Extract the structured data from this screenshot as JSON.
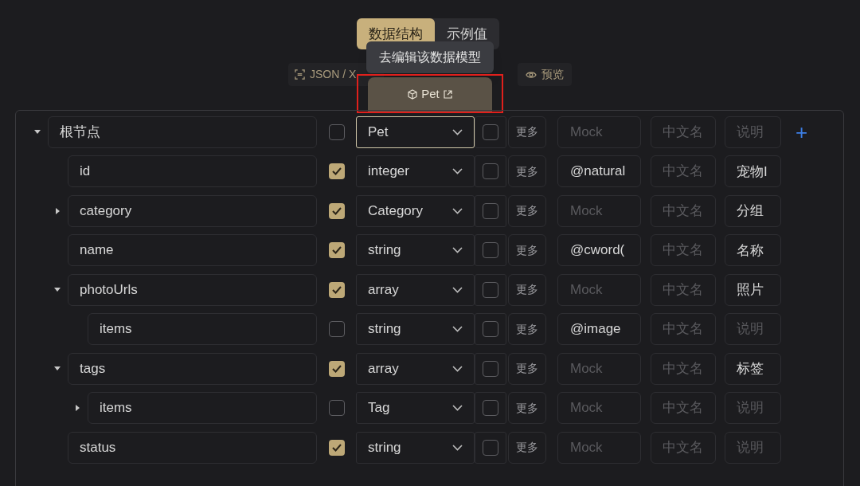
{
  "tabs": [
    {
      "label": "数据结构",
      "selected": true
    },
    {
      "label": "示例值",
      "selected": false
    }
  ],
  "toolbar": {
    "import_label": "JSON / X",
    "preview_label": "预览"
  },
  "tooltip": {
    "text": "去编辑该数据模型"
  },
  "model_button": {
    "label": "Pet",
    "highlighted": true
  },
  "tree": {
    "name": {
      "value": "根节点"
    },
    "required": false,
    "type": "Pet",
    "type_focused": true,
    "nullable": false,
    "more": "更多",
    "mock": {
      "placeholder": "Mock"
    },
    "cn_name": {
      "placeholder": "中文名"
    },
    "desc": {
      "placeholder": "说明"
    },
    "expanded": true,
    "add_button": "+",
    "children": [
      {
        "name": {
          "value": "id"
        },
        "required": true,
        "type": "integer",
        "type_focused": false,
        "nullable": false,
        "more": "更多",
        "mock": {
          "value": "@natural"
        },
        "cn_name": {
          "placeholder": "中文名"
        },
        "desc": {
          "value": "宠物I"
        }
      },
      {
        "name": {
          "value": "category"
        },
        "required": true,
        "type": "Category",
        "type_focused": false,
        "nullable": false,
        "more": "更多",
        "mock": {
          "placeholder": "Mock"
        },
        "cn_name": {
          "placeholder": "中文名"
        },
        "desc": {
          "value": "分组"
        },
        "expanded": false
      },
      {
        "name": {
          "value": "name"
        },
        "required": true,
        "type": "string",
        "type_focused": false,
        "nullable": false,
        "more": "更多",
        "mock": {
          "value": "@cword("
        },
        "cn_name": {
          "placeholder": "中文名"
        },
        "desc": {
          "value": "名称"
        }
      },
      {
        "name": {
          "value": "photoUrls"
        },
        "required": true,
        "type": "array",
        "type_focused": false,
        "nullable": false,
        "more": "更多",
        "mock": {
          "placeholder": "Mock"
        },
        "cn_name": {
          "placeholder": "中文名"
        },
        "desc": {
          "value": "照片"
        },
        "expanded": true,
        "children": [
          {
            "name": {
              "value": "items"
            },
            "required": false,
            "type": "string",
            "type_focused": false,
            "nullable": false,
            "more": "更多",
            "mock": {
              "value": "@image"
            },
            "cn_name": {
              "placeholder": "中文名"
            },
            "desc": {
              "placeholder": "说明"
            }
          }
        ]
      },
      {
        "name": {
          "value": "tags"
        },
        "required": true,
        "type": "array",
        "type_focused": false,
        "nullable": false,
        "more": "更多",
        "mock": {
          "placeholder": "Mock"
        },
        "cn_name": {
          "placeholder": "中文名"
        },
        "desc": {
          "value": "标签"
        },
        "expanded": true,
        "children": [
          {
            "name": {
              "value": "items"
            },
            "required": false,
            "type": "Tag",
            "type_focused": false,
            "nullable": false,
            "more": "更多",
            "mock": {
              "placeholder": "Mock"
            },
            "cn_name": {
              "placeholder": "中文名"
            },
            "desc": {
              "placeholder": "说明"
            },
            "expanded": false
          }
        ]
      },
      {
        "name": {
          "value": "status"
        },
        "required": true,
        "type": "string",
        "type_focused": false,
        "nullable": false,
        "more": "更多",
        "mock": {
          "placeholder": "Mock"
        },
        "cn_name": {
          "placeholder": "中文名"
        },
        "desc": {
          "placeholder": "说明"
        }
      }
    ]
  }
}
